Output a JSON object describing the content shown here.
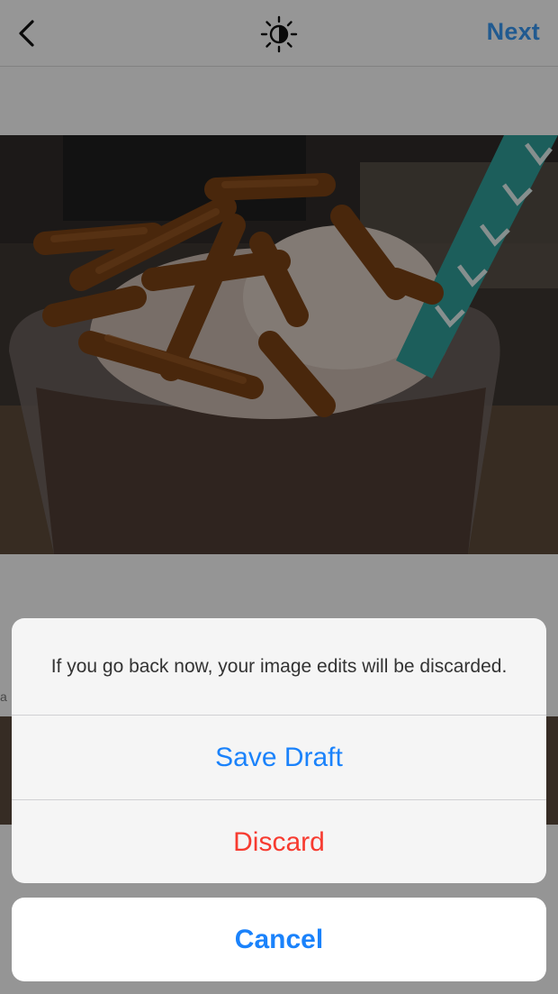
{
  "header": {
    "back_icon": "chevron-left-icon",
    "brightness_icon": "brightness-icon",
    "next_label": "Next",
    "accent_color": "#3897f0"
  },
  "tool_strip": {
    "partial_label": "a"
  },
  "action_sheet": {
    "message": "If you go back now, your image edits will be discarded.",
    "save_draft_label": "Save Draft",
    "discard_label": "Discard",
    "cancel_label": "Cancel",
    "save_color": "#1a82fb",
    "discard_color": "#f73b30"
  }
}
